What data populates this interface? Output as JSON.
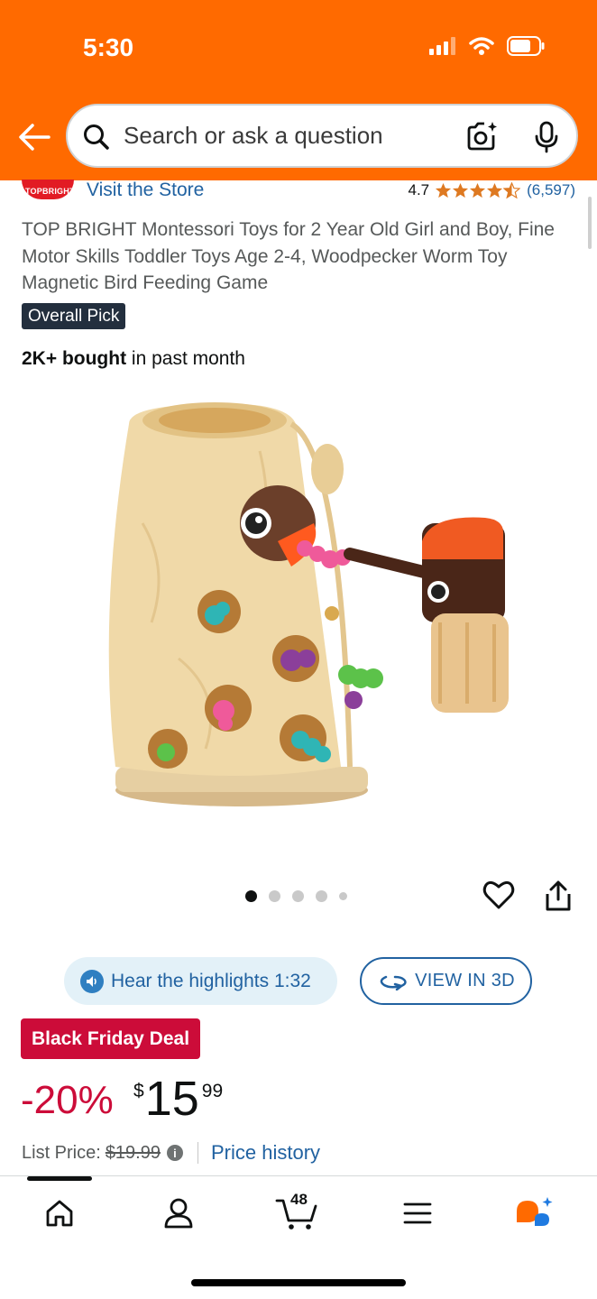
{
  "status_bar": {
    "time": "5:30"
  },
  "header": {
    "search_placeholder": "Search or ask a question",
    "accent_color": "#ff6a00"
  },
  "store": {
    "logo_text": "TOPBRIGHT",
    "visit_label": "Visit the Store",
    "rating_value": "4.7",
    "rating_stars": 4.5,
    "rating_count": "(6,597)"
  },
  "product": {
    "title": "TOP BRIGHT Montessori Toys for 2 Year Old Girl and Boy, Fine Motor Skills Toddler Toys Age 2-4, Woodpecker Worm Toy Magnetic Bird Feeding Game",
    "badge": "Overall Pick",
    "bought_bold": "2K+ bought",
    "bought_rest": " in past month",
    "image_count": 5,
    "image_active": 1
  },
  "actions": {
    "hear_label": "Hear the highlights 1:32",
    "view3d_label": "VIEW IN 3D"
  },
  "pricing": {
    "deal_label": "Black Friday Deal",
    "discount": "-20%",
    "currency": "$",
    "price_whole": "15",
    "price_fraction": "99",
    "list_price_label": "List Price:",
    "list_price_value": "$19.99",
    "price_history_label": "Price history",
    "deal_color": "#cc0c39"
  },
  "nav": {
    "cart_count": "48",
    "items": [
      "home-icon",
      "account-icon",
      "cart-icon",
      "menu-icon",
      "rufus-icon"
    ]
  }
}
